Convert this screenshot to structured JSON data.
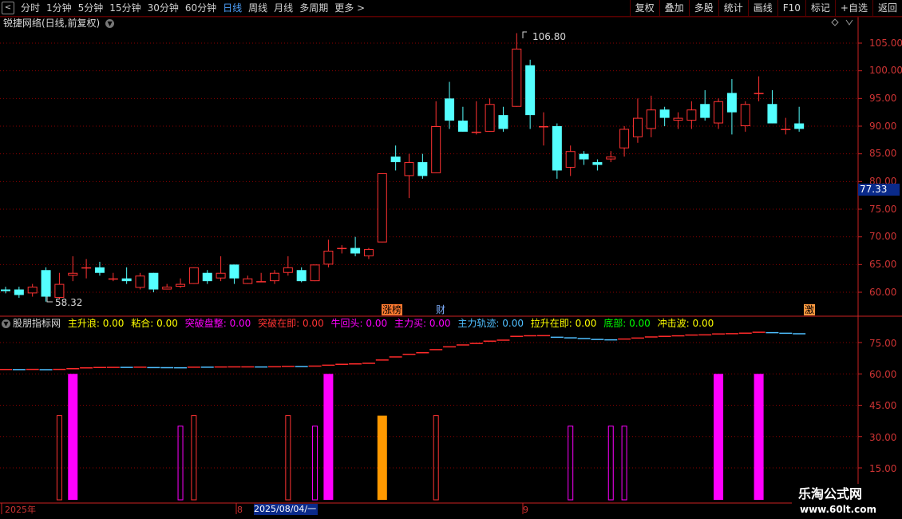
{
  "toolbar": {
    "periods": [
      "分时",
      "1分钟",
      "5分钟",
      "15分钟",
      "30分钟",
      "60分钟",
      "日线",
      "周线",
      "月线",
      "多周期",
      "更多 >"
    ],
    "active_period": "日线",
    "buttons": [
      "复权",
      "叠加",
      "多股",
      "统计",
      "画线",
      "F10",
      "标记",
      "+自选",
      "返回"
    ]
  },
  "main_chart": {
    "title": "锐捷网络(日线,前复权)",
    "y_ticks": [
      "105.00",
      "100.00",
      "95.00",
      "90.00",
      "85.00",
      "80.00",
      "75.00",
      "70.00",
      "65.00",
      "60.00"
    ],
    "last_price_tag": "77.33",
    "high_label": "106.80",
    "low_label": "58.32",
    "event_tags": [
      "涨榜",
      "财",
      "激"
    ],
    "colors": {
      "up": "#ff3232",
      "down": "#54ffff",
      "axis": "#cc3333"
    }
  },
  "indicator": {
    "name": "股朋指标网",
    "fields": [
      {
        "label": "主升浪:",
        "value": "0.00",
        "color": "#ffff00"
      },
      {
        "label": "粘合:",
        "value": "0.00",
        "color": "#ffff00"
      },
      {
        "label": "突破盘整:",
        "value": "0.00",
        "color": "#ff00ff"
      },
      {
        "label": "突破在即:",
        "value": "0.00",
        "color": "#ff3333"
      },
      {
        "label": "牛回头:",
        "value": "0.00",
        "color": "#ff00ff"
      },
      {
        "label": "主力买:",
        "value": "0.00",
        "color": "#ff00ff"
      },
      {
        "label": "主力轨迹:",
        "value": "0.00",
        "color": "#4fbfff"
      },
      {
        "label": "拉升在即:",
        "value": "0.00",
        "color": "#ffff00"
      },
      {
        "label": "底部:",
        "value": "0.00",
        "color": "#00ff00"
      },
      {
        "label": "冲击波:",
        "value": "0.00",
        "color": "#ffff00"
      }
    ],
    "y_ticks": [
      "75.00",
      "60.00",
      "45.00",
      "30.00",
      "15.00"
    ]
  },
  "date_axis": {
    "labels": [
      "2025年",
      "8",
      "9"
    ],
    "selected_date": "2025/08/04/一"
  },
  "chart_data": {
    "type": "candlestick",
    "ylim": [
      57,
      108
    ],
    "candles": [
      {
        "o": 60.5,
        "c": 60.2,
        "h": 61.0,
        "l": 59.8
      },
      {
        "o": 60.5,
        "c": 59.5,
        "h": 61.0,
        "l": 59.0
      },
      {
        "o": 59.8,
        "c": 61.0,
        "h": 61.5,
        "l": 59.2
      },
      {
        "o": 64.0,
        "c": 59.2,
        "h": 64.5,
        "l": 58.3
      },
      {
        "o": 59.0,
        "c": 61.5,
        "h": 63.5,
        "l": 58.8
      },
      {
        "o": 63.0,
        "c": 63.5,
        "h": 66.5,
        "l": 62.0
      },
      {
        "o": 64.5,
        "c": 64.5,
        "h": 66.0,
        "l": 62.5
      },
      {
        "o": 64.5,
        "c": 63.5,
        "h": 65.5,
        "l": 63.0
      },
      {
        "o": 62.5,
        "c": 62.5,
        "h": 63.5,
        "l": 62.0
      },
      {
        "o": 62.5,
        "c": 62.0,
        "h": 64.5,
        "l": 61.5
      },
      {
        "o": 60.8,
        "c": 63.0,
        "h": 63.5,
        "l": 60.5
      },
      {
        "o": 63.5,
        "c": 60.5,
        "h": 63.5,
        "l": 60.0
      },
      {
        "o": 60.5,
        "c": 61.0,
        "h": 61.5,
        "l": 60.5
      },
      {
        "o": 61.0,
        "c": 61.5,
        "h": 62.5,
        "l": 60.8
      },
      {
        "o": 61.5,
        "c": 64.5,
        "h": 64.5,
        "l": 61.5
      },
      {
        "o": 63.5,
        "c": 62.0,
        "h": 64.0,
        "l": 61.5
      },
      {
        "o": 62.5,
        "c": 63.5,
        "h": 66.5,
        "l": 62.0
      },
      {
        "o": 65.0,
        "c": 62.5,
        "h": 65.0,
        "l": 61.5
      },
      {
        "o": 61.5,
        "c": 62.5,
        "h": 63.0,
        "l": 61.5
      },
      {
        "o": 62.0,
        "c": 62.0,
        "h": 63.5,
        "l": 61.8
      },
      {
        "o": 62.0,
        "c": 63.5,
        "h": 64.0,
        "l": 61.5
      },
      {
        "o": 63.5,
        "c": 64.5,
        "h": 66.5,
        "l": 63.0
      },
      {
        "o": 64.0,
        "c": 62.0,
        "h": 64.5,
        "l": 61.8
      },
      {
        "o": 62.0,
        "c": 65.0,
        "h": 65.0,
        "l": 62.0
      },
      {
        "o": 65.0,
        "c": 67.5,
        "h": 69.5,
        "l": 64.5
      },
      {
        "o": 68.0,
        "c": 68.0,
        "h": 68.5,
        "l": 67.0
      },
      {
        "o": 68.0,
        "c": 67.0,
        "h": 70.0,
        "l": 66.5
      },
      {
        "o": 66.5,
        "c": 67.8,
        "h": 68.0,
        "l": 66.0
      },
      {
        "o": 69.0,
        "c": 81.5,
        "h": 81.5,
        "l": 69.0
      },
      {
        "o": 84.5,
        "c": 83.5,
        "h": 86.5,
        "l": 82.0
      },
      {
        "o": 81.0,
        "c": 83.5,
        "h": 85.0,
        "l": 77.0
      },
      {
        "o": 83.5,
        "c": 81.0,
        "h": 85.0,
        "l": 80.5
      },
      {
        "o": 81.5,
        "c": 90.0,
        "h": 94.5,
        "l": 81.5
      },
      {
        "o": 95.0,
        "c": 91.0,
        "h": 98.0,
        "l": 89.5
      },
      {
        "o": 91.0,
        "c": 89.0,
        "h": 93.5,
        "l": 89.0
      },
      {
        "o": 89.0,
        "c": 89.0,
        "h": 94.5,
        "l": 88.5
      },
      {
        "o": 89.0,
        "c": 94.0,
        "h": 95.0,
        "l": 89.0
      },
      {
        "o": 92.0,
        "c": 89.5,
        "h": 93.5,
        "l": 89.0
      },
      {
        "o": 93.5,
        "c": 104.0,
        "h": 106.8,
        "l": 93.5
      },
      {
        "o": 101.0,
        "c": 92.0,
        "h": 102.0,
        "l": 89.5
      },
      {
        "o": 90.0,
        "c": 90.0,
        "h": 92.5,
        "l": 86.5
      },
      {
        "o": 90.0,
        "c": 82.0,
        "h": 90.5,
        "l": 80.5
      },
      {
        "o": 82.5,
        "c": 85.5,
        "h": 86.5,
        "l": 81.0
      },
      {
        "o": 85.0,
        "c": 84.0,
        "h": 85.5,
        "l": 83.0
      },
      {
        "o": 83.5,
        "c": 83.0,
        "h": 84.0,
        "l": 82.0
      },
      {
        "o": 84.0,
        "c": 84.5,
        "h": 85.5,
        "l": 83.5
      },
      {
        "o": 86.0,
        "c": 89.5,
        "h": 90.0,
        "l": 84.5
      },
      {
        "o": 88.0,
        "c": 91.5,
        "h": 95.0,
        "l": 87.0
      },
      {
        "o": 89.5,
        "c": 93.0,
        "h": 95.5,
        "l": 88.0
      },
      {
        "o": 93.0,
        "c": 91.5,
        "h": 93.5,
        "l": 90.0
      },
      {
        "o": 91.0,
        "c": 91.5,
        "h": 92.5,
        "l": 89.5
      },
      {
        "o": 91.0,
        "c": 93.0,
        "h": 94.5,
        "l": 89.5
      },
      {
        "o": 94.0,
        "c": 91.5,
        "h": 96.5,
        "l": 91.0
      },
      {
        "o": 90.5,
        "c": 94.5,
        "h": 95.0,
        "l": 89.5
      },
      {
        "o": 96.0,
        "c": 92.5,
        "h": 98.5,
        "l": 88.5
      },
      {
        "o": 90.0,
        "c": 94.0,
        "h": 94.5,
        "l": 89.0
      },
      {
        "o": 96.0,
        "c": 96.0,
        "h": 99.0,
        "l": 94.5
      },
      {
        "o": 94.0,
        "c": 90.5,
        "h": 96.5,
        "l": 90.5
      },
      {
        "o": 89.5,
        "c": 89.5,
        "h": 91.5,
        "l": 88.5
      },
      {
        "o": 90.5,
        "c": 89.5,
        "h": 93.5,
        "l": 89.0
      }
    ],
    "indicator": {
      "ylim": [
        8,
        90
      ],
      "trail_up_color": "#ff2a2a",
      "trail_down_color": "#4fbfff",
      "bars": [
        {
          "i": 4,
          "v": 40,
          "kind": "outline_red"
        },
        {
          "i": 5,
          "v": 60,
          "kind": "fill_magenta"
        },
        {
          "i": 13,
          "v": 35,
          "kind": "outline_magenta"
        },
        {
          "i": 14,
          "v": 40,
          "kind": "outline_red"
        },
        {
          "i": 21,
          "v": 40,
          "kind": "outline_red"
        },
        {
          "i": 23,
          "v": 35,
          "kind": "outline_magenta"
        },
        {
          "i": 24,
          "v": 60,
          "kind": "fill_magenta"
        },
        {
          "i": 28,
          "v": 40,
          "kind": "fill_orange"
        },
        {
          "i": 32,
          "v": 40,
          "kind": "outline_red"
        },
        {
          "i": 42,
          "v": 35,
          "kind": "outline_magenta"
        },
        {
          "i": 45,
          "v": 35,
          "kind": "outline_magenta"
        },
        {
          "i": 46,
          "v": 35,
          "kind": "outline_magenta"
        },
        {
          "i": 53,
          "v": 60,
          "kind": "fill_magenta"
        },
        {
          "i": 56,
          "v": 60,
          "kind": "fill_magenta"
        }
      ]
    }
  },
  "watermark": {
    "line1": "乐淘公式网",
    "line2": "www.60lt.com"
  }
}
